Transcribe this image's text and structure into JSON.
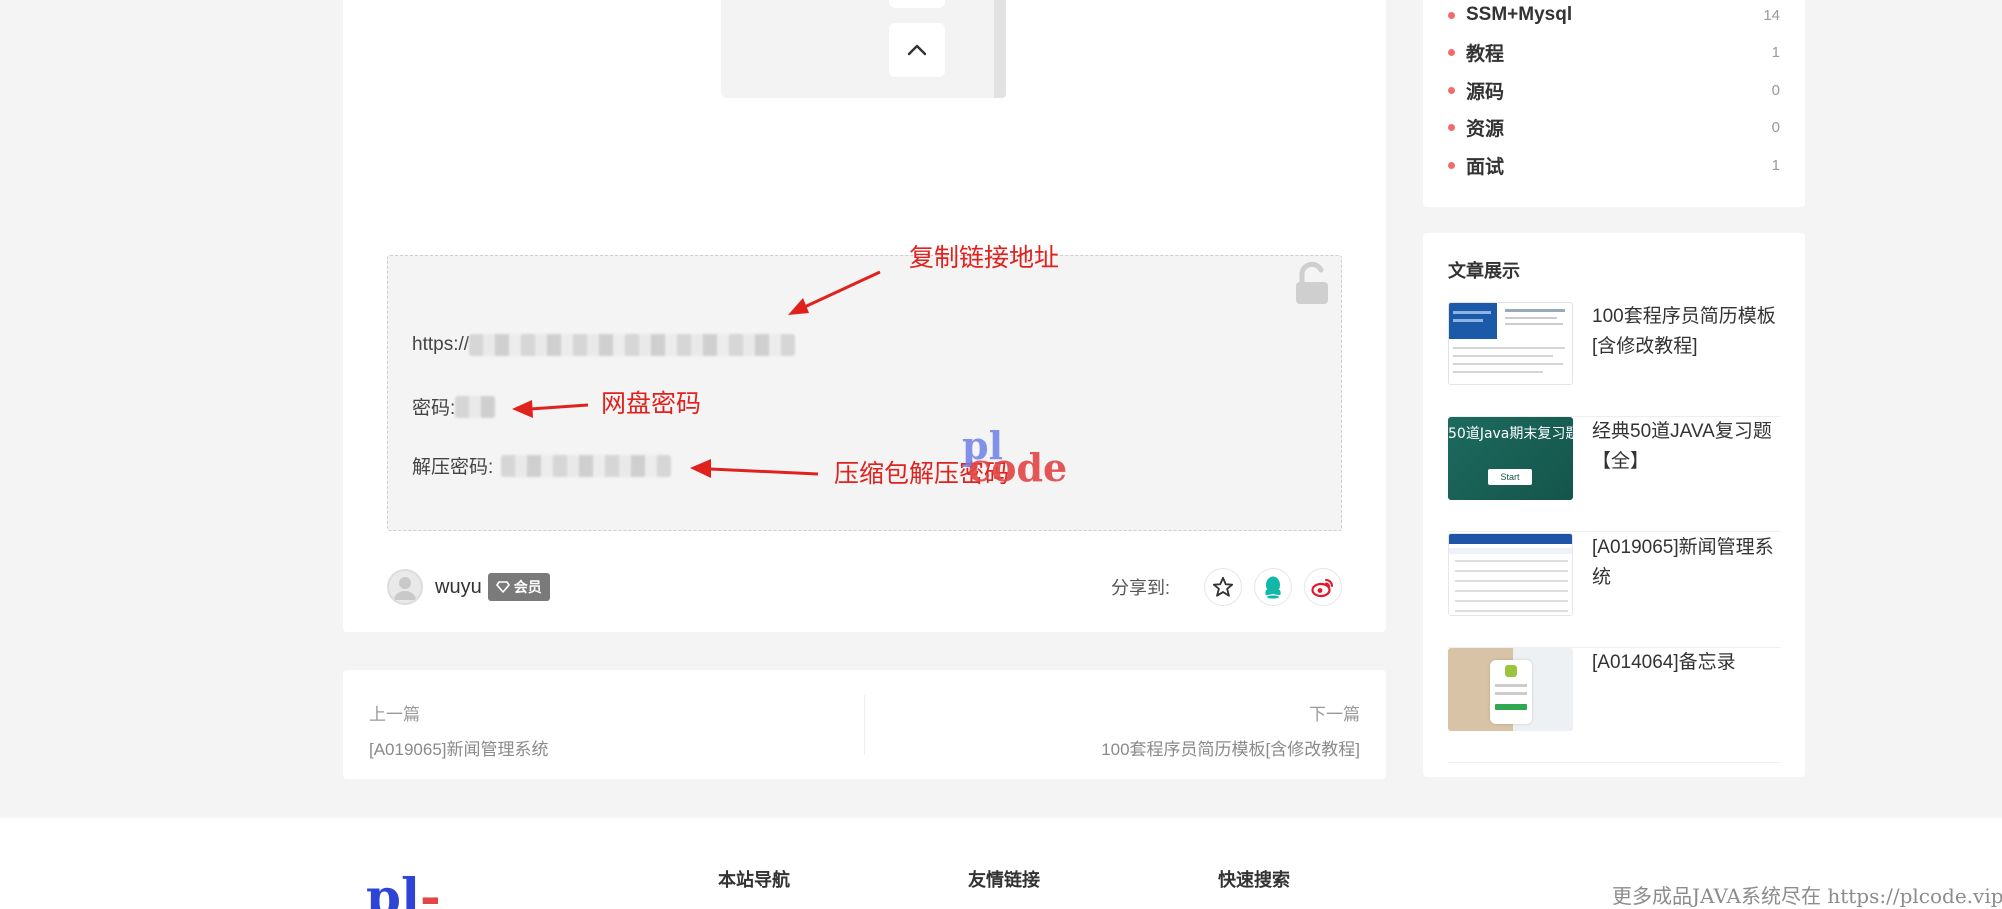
{
  "resource": {
    "url_prefix": "https://",
    "password_label": "密码:",
    "unzip_label": "解压密码:"
  },
  "annotations": {
    "copy_link": "复制链接地址",
    "disk_password": "网盘密码",
    "unzip_password": "压缩包解压密码"
  },
  "watermark_logo": {
    "line1": "pl",
    "line2": "code"
  },
  "author": {
    "name": "wuyu",
    "badge": "会员"
  },
  "share": {
    "label": "分享到:"
  },
  "post_nav": {
    "prev_label": "上一篇",
    "prev_title": "[A019065]新闻管理系统",
    "next_label": "下一篇",
    "next_title": "100套程序员简历模板[含修改教程]"
  },
  "categories": [
    {
      "name": "SSM+Mysql",
      "count": "14"
    },
    {
      "name": "教程",
      "count": "1"
    },
    {
      "name": "源码",
      "count": "0"
    },
    {
      "name": "资源",
      "count": "0"
    },
    {
      "name": "面试",
      "count": "1"
    }
  ],
  "article_showcase": {
    "title": "文章展示",
    "items": [
      {
        "title": "100套程序员简历模板[含修改教程]"
      },
      {
        "title": "经典50道JAVA复习题【全】",
        "thumb_text": "50道Java期末复习题",
        "thumb_btn": "Start"
      },
      {
        "title": "[A019065]新闻管理系统"
      },
      {
        "title": "[A014064]备忘录"
      }
    ]
  },
  "footer": {
    "logo": "pl",
    "col1": "本站导航",
    "col2": "友情链接",
    "col3": "快速搜索",
    "watermark": "更多成品JAVA系统尽在 https://plcode.vip"
  },
  "colors": {
    "accent_red": "#e0221f",
    "category_dot": "#f26b6b",
    "logo_blue": "#2d44d6"
  }
}
